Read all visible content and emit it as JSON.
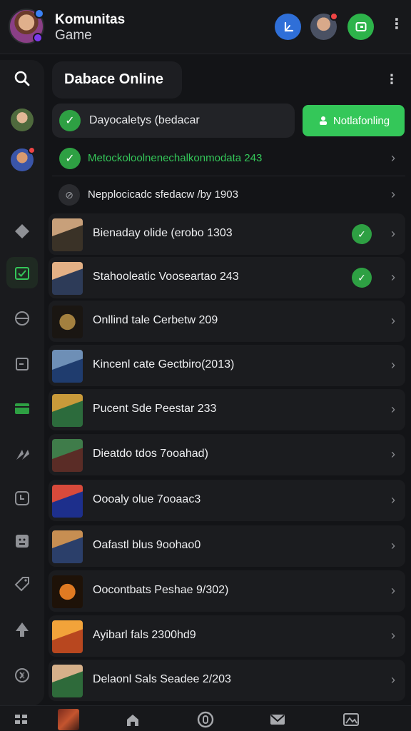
{
  "header": {
    "title": "Komunitas",
    "subtitle": "Game",
    "buttons": [
      {
        "icon": "nav-arrow-icon",
        "color": "#2f6fd8"
      },
      {
        "icon": "profile-avatar",
        "has_notification": true
      },
      {
        "icon": "screen-icon",
        "color": "#2db34a"
      }
    ]
  },
  "sidebar": {
    "items": [
      {
        "icon": "search-icon"
      },
      {
        "icon": "friend-avatar"
      },
      {
        "icon": "friend-avatar-notified"
      },
      {
        "icon": "diamond-icon"
      },
      {
        "icon": "calendar-check-icon",
        "active": true
      },
      {
        "icon": "globe-icon"
      },
      {
        "icon": "document-icon"
      },
      {
        "icon": "chest-icon"
      },
      {
        "icon": "sword-icon"
      },
      {
        "icon": "clock-icon"
      },
      {
        "icon": "face-icon"
      },
      {
        "icon": "tag-icon"
      },
      {
        "icon": "leaf-icon"
      },
      {
        "icon": "swap-icon"
      }
    ]
  },
  "main": {
    "page_title": "Dabace Online",
    "status": {
      "text": "Dayocaletys (bedacar",
      "notify_label": "Notlafonling"
    },
    "info_rows": [
      {
        "text": "Metockoloolnenechalkonmodata 243",
        "status": "verified"
      },
      {
        "text": "Nepplocicadc sfedacw /by 1903",
        "status": "pending"
      }
    ],
    "games": [
      {
        "title": "Bienaday olide (erobo 1303",
        "verified": true,
        "thumb": [
          "#3a3227",
          "#c8a07a"
        ]
      },
      {
        "title": "Stahooleatic Vooseartao 243",
        "verified": true,
        "thumb": [
          "#2d3b58",
          "#e3b085"
        ]
      },
      {
        "title": "Onllind tale Cerbetw 209",
        "verified": false,
        "thumb": [
          "#1a1612",
          "#a3803f"
        ]
      },
      {
        "title": "Kincenl cate Gectbiro(2013)",
        "verified": false,
        "thumb": [
          "#1f3c6e",
          "#6e8fb6"
        ]
      },
      {
        "title": "Pucent Sde Peestar 233",
        "verified": false,
        "thumb": [
          "#2c6b3c",
          "#c99a3a"
        ]
      },
      {
        "title": "Dieatdo tdos 7ooahad)",
        "verified": false,
        "thumb": [
          "#5a2c26",
          "#3f7c4a"
        ]
      },
      {
        "title": "Oooaly olue 7ooaac3",
        "verified": false,
        "thumb": [
          "#1d2f8c",
          "#d84a3b"
        ]
      },
      {
        "title": "Oafastl blus 9oohao0",
        "verified": false,
        "thumb": [
          "#2b3f6a",
          "#c78e52"
        ]
      },
      {
        "title": "Oocontbats Peshae 9/302)",
        "verified": false,
        "thumb": [
          "#1e1208",
          "#e07a22"
        ]
      },
      {
        "title": "Ayibarl fals 2300hd9",
        "verified": false,
        "thumb": [
          "#b8471f",
          "#f2a33a"
        ]
      },
      {
        "title": "Delaonl Sals Seadee 2/203",
        "verified": false,
        "thumb": [
          "#2e6a3a",
          "#d6b08a"
        ]
      }
    ]
  },
  "bottom_nav": {
    "tabs": [
      {
        "icon": "grid-icon"
      },
      {
        "icon": "game-thumb-icon"
      },
      {
        "icon": "home-icon"
      },
      {
        "icon": "zero-circle-icon"
      },
      {
        "icon": "mail-icon",
        "active": true
      },
      {
        "icon": "image-icon"
      }
    ]
  },
  "colors": {
    "accent_green": "#34c759",
    "check_green": "#2ea043",
    "background": "#131417",
    "card": "#1b1c1f"
  }
}
